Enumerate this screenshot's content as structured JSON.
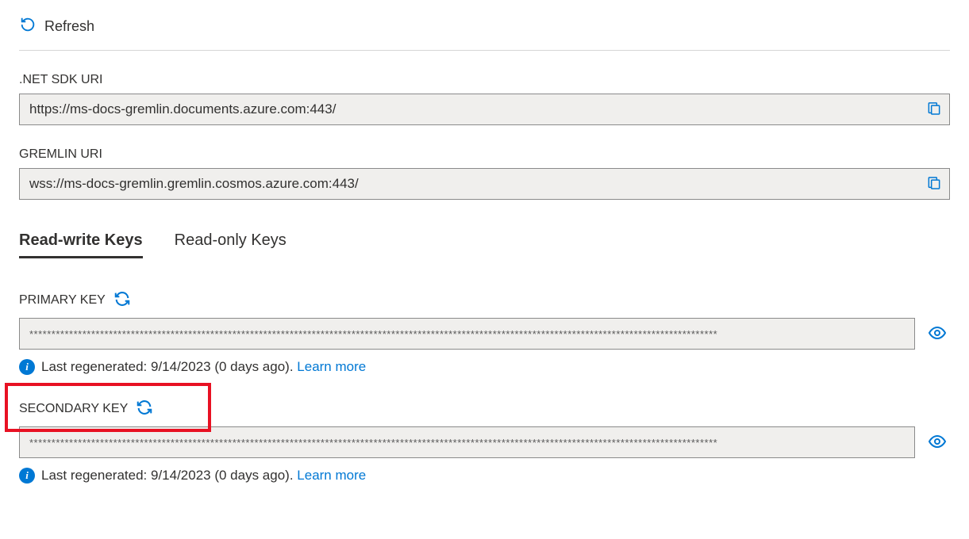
{
  "toolbar": {
    "refresh_label": "Refresh"
  },
  "fields": {
    "net_sdk_uri": {
      "label": ".NET SDK URI",
      "value": "https://ms-docs-gremlin.documents.azure.com:443/"
    },
    "gremlin_uri": {
      "label": "GREMLIN URI",
      "value": "wss://ms-docs-gremlin.gremlin.cosmos.azure.com:443/"
    }
  },
  "tabs": {
    "readwrite": "Read-write Keys",
    "readonly": "Read-only Keys"
  },
  "keys": {
    "primary": {
      "label": "PRIMARY KEY",
      "masked_value": "************************************************************************************************************************************************************",
      "regen_text": "Last regenerated: 9/14/2023 (0 days ago). ",
      "learn_more": "Learn more"
    },
    "secondary": {
      "label": "SECONDARY KEY",
      "masked_value": "************************************************************************************************************************************************************",
      "regen_text": "Last regenerated: 9/14/2023 (0 days ago). ",
      "learn_more": "Learn more"
    }
  },
  "colors": {
    "link": "#0078d4",
    "highlight": "#e81123"
  }
}
